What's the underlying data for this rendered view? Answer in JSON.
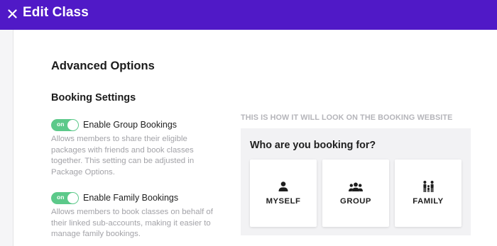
{
  "header": {
    "title": "Edit Class",
    "close_icon": "close-icon",
    "color": "#5019c7"
  },
  "section": {
    "title": "Advanced Options",
    "subtitle": "Booking Settings"
  },
  "options": [
    {
      "toggle_text": "on",
      "enabled": true,
      "label": "Enable Group Bookings",
      "description": "Allows members to share their eligible packages with friends and book classes together. This setting can be adjusted in Package Options."
    },
    {
      "toggle_text": "on",
      "enabled": true,
      "label": "Enable Family Bookings",
      "description": "Allows members to book classes on behalf of their linked sub-accounts, making it easier to manage family bookings."
    }
  ],
  "preview": {
    "caption": "THIS IS HOW IT WILL LOOK ON THE BOOKING WEBSITE",
    "question": "Who are you booking for?",
    "choices": [
      {
        "label": "MYSELF",
        "icon": "person-icon"
      },
      {
        "label": "GROUP",
        "icon": "group-icon"
      },
      {
        "label": "FAMILY",
        "icon": "family-icon"
      }
    ]
  },
  "colors": {
    "toggle_on": "#5cc98a",
    "muted_text": "#a3a3a8"
  }
}
